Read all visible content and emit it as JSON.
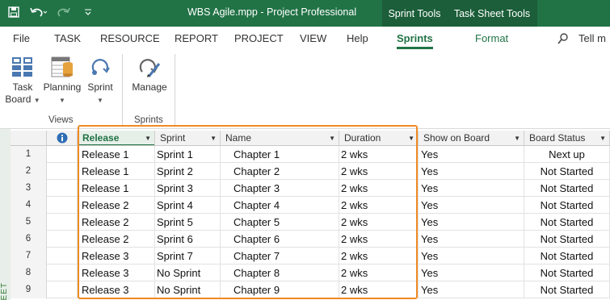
{
  "titlebar": {
    "title": "WBS Agile.mpp  -  Project Professional",
    "context_tabs": [
      "Sprint Tools",
      "Task Sheet Tools"
    ]
  },
  "tabs": [
    "File",
    "TASK",
    "RESOURCE",
    "REPORT",
    "PROJECT",
    "VIEW",
    "Help",
    "Sprints",
    "Format"
  ],
  "active_tab": "Sprints",
  "tell_me": "Tell m",
  "ribbon": {
    "views_group": {
      "label": "Views",
      "buttons": [
        {
          "line1": "Task",
          "line2": "Board"
        },
        {
          "line1": "Planning",
          "line2": ""
        },
        {
          "line1": "Sprint",
          "line2": ""
        }
      ]
    },
    "sprints_group": {
      "label": "Sprints",
      "buttons": [
        {
          "line1": "Manage",
          "line2": ""
        }
      ]
    }
  },
  "sheet": {
    "side_label": "EET",
    "columns": [
      "Release",
      "Sprint",
      "Name",
      "Duration",
      "Show on Board",
      "Board Status"
    ],
    "rows": [
      {
        "id": "1",
        "release": "Release 1",
        "sprint": "Sprint 1",
        "name": "Chapter 1",
        "duration": "2 wks",
        "show": "Yes",
        "status": "Next up"
      },
      {
        "id": "2",
        "release": "Release 1",
        "sprint": "Sprint 2",
        "name": "Chapter 2",
        "duration": "2 wks",
        "show": "Yes",
        "status": "Not Started"
      },
      {
        "id": "3",
        "release": "Release 1",
        "sprint": "Sprint 3",
        "name": "Chapter 3",
        "duration": "2 wks",
        "show": "Yes",
        "status": "Not Started"
      },
      {
        "id": "4",
        "release": "Release 2",
        "sprint": "Sprint 4",
        "name": "Chapter 4",
        "duration": "2 wks",
        "show": "Yes",
        "status": "Not Started"
      },
      {
        "id": "5",
        "release": "Release 2",
        "sprint": "Sprint 5",
        "name": "Chapter 5",
        "duration": "2 wks",
        "show": "Yes",
        "status": "Not Started"
      },
      {
        "id": "6",
        "release": "Release 2",
        "sprint": "Sprint 6",
        "name": "Chapter 6",
        "duration": "2 wks",
        "show": "Yes",
        "status": "Not Started"
      },
      {
        "id": "7",
        "release": "Release 3",
        "sprint": "Sprint 7",
        "name": "Chapter 7",
        "duration": "2 wks",
        "show": "Yes",
        "status": "Not Started"
      },
      {
        "id": "8",
        "release": "Release 3",
        "sprint": "No Sprint",
        "name": "Chapter 8",
        "duration": "2 wks",
        "show": "Yes",
        "status": "Not Started"
      },
      {
        "id": "9",
        "release": "Release 3",
        "sprint": "No Sprint",
        "name": "Chapter 9",
        "duration": "2 wks",
        "show": "Yes",
        "status": "Not Started"
      }
    ]
  },
  "colors": {
    "accent": "#217346",
    "highlight": "#f08a24"
  }
}
